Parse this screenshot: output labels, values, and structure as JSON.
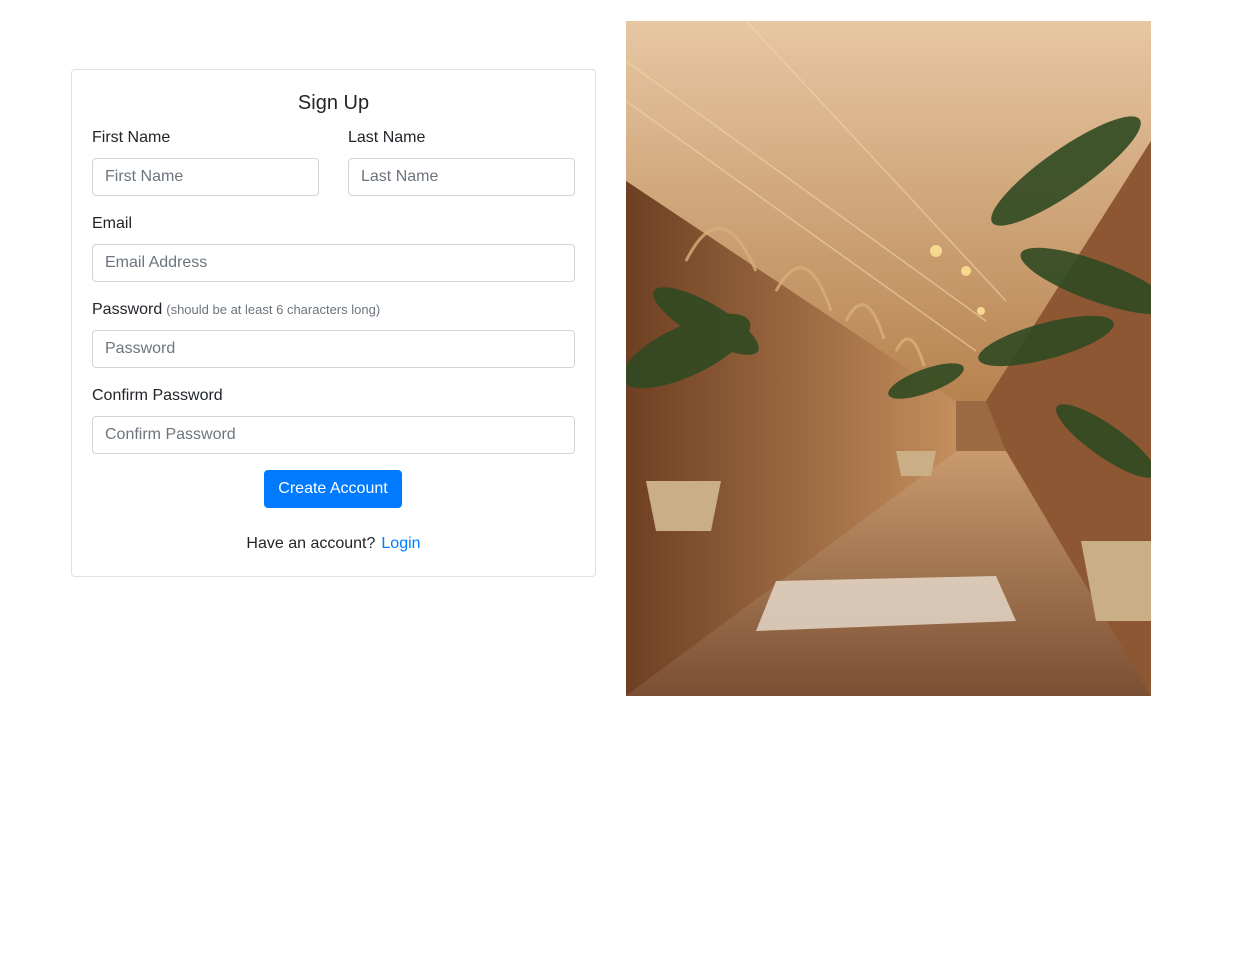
{
  "form": {
    "title": "Sign Up",
    "first_name": {
      "label": "First Name",
      "placeholder": "First Name"
    },
    "last_name": {
      "label": "Last Name",
      "placeholder": "Last Name"
    },
    "email": {
      "label": "Email",
      "placeholder": "Email Address"
    },
    "password": {
      "label": "Password",
      "hint": "(should be at least 6 characters long)",
      "placeholder": "Password"
    },
    "confirm_password": {
      "label": "Confirm Password",
      "placeholder": "Confirm Password"
    },
    "submit_label": "Create Account",
    "footer_text": "Have an account?",
    "login_link": "Login"
  },
  "colors": {
    "primary": "#007bff",
    "border": "#ced4da",
    "card_border": "#dfe2e5"
  }
}
